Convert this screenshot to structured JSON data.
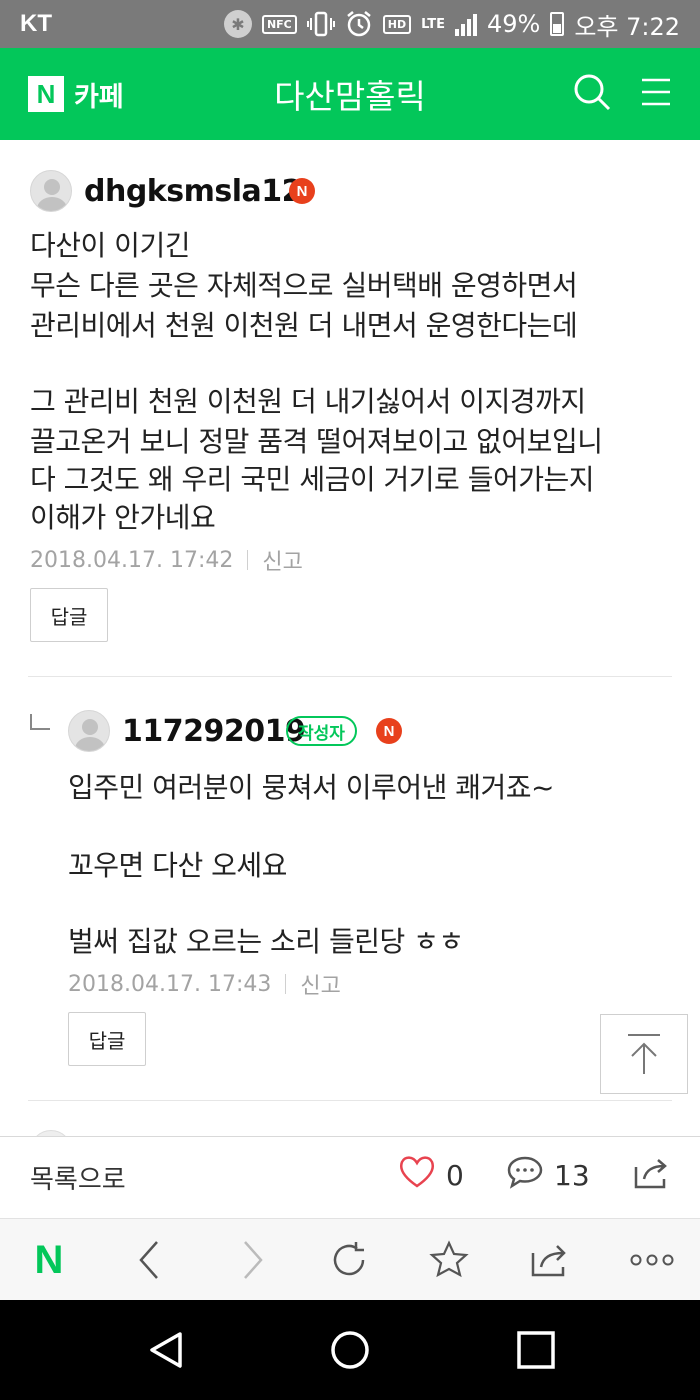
{
  "status_bar": {
    "carrier": "KT",
    "nfc": "NFC",
    "hd": "HD",
    "lte": "LTE",
    "battery": "49%",
    "time": "오후 7:22"
  },
  "header": {
    "brand_letter": "N",
    "brand_label": "카페",
    "cafe_name": "다산맘홀릭",
    "search_icon": "search-icon",
    "menu_icon": "hamburger-menu-icon",
    "accent_color": "#03c75a"
  },
  "comments": [
    {
      "nickname": "dhgksmsla12",
      "badge": "N",
      "lines": [
        "다산이 이기긴",
        "무슨 다른 곳은 자체적으로 실버택배 운영하면서",
        "관리비에서 천원 이천원 더 내면서 운영한다는데",
        "",
        "그 관리비 천원 이천원 더 내기싫어서 이지경까지",
        "끌고온거 보니 정말 품격 떨어져보이고 없어보입니",
        "다 그것도 왜 우리 국민 세금이 거기로 들어가는지",
        "이해가 안가네요"
      ],
      "date": "2018.04.17. 17:42",
      "report": "신고",
      "reply": "답글"
    },
    {
      "nickname": "117292019",
      "writer_badge": "작성자",
      "badge": "N",
      "lines": [
        "입주민 여러분이 뭉쳐서 이루어낸 쾌거죠~",
        "",
        "꼬우면 다산 오세요",
        "",
        "벌써 집값 오르는 소리 들린당 ㅎㅎ"
      ],
      "date": "2018.04.17. 17:43",
      "report": "신고",
      "reply": "답글"
    }
  ],
  "action_bar": {
    "back_to_list": "목록으로",
    "likes": "0",
    "comments": "13"
  },
  "browser_bar": {
    "home_letter": "N"
  }
}
